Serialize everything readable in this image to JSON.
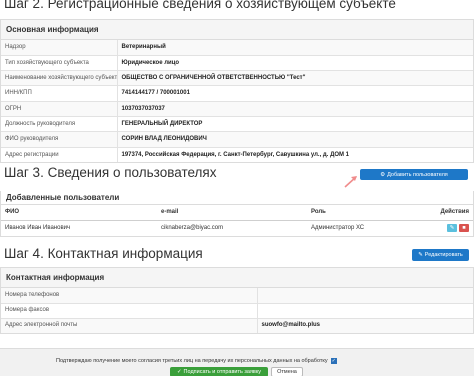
{
  "step2": {
    "title": "Шаг 2. Регистрационные сведения о хозяйствующем субъекте",
    "panel_title": "Основная информация",
    "rows": [
      {
        "label": "Надзор",
        "value": "Ветеринарный"
      },
      {
        "label": "Тип хозяйствующего субъекта",
        "value": "Юридическое лицо"
      },
      {
        "label": "Наименование хозяйствующего субъекта",
        "value": "ОБЩЕСТВО С ОГРАНИЧЕННОЙ ОТВЕТСТВЕННОСТЬЮ \"Тест\""
      },
      {
        "label": "ИНН/КПП",
        "value": "7414144177 / 700001001"
      },
      {
        "label": "ОГРН",
        "value": "1037037037037"
      },
      {
        "label": "Должность руководителя",
        "value": "ГЕНЕРАЛЬНЫЙ ДИРЕКТОР"
      },
      {
        "label": "ФИО руководителя",
        "value": "СОРИН ВЛАД ЛЕОНИДОВИЧ"
      },
      {
        "label": "Адрес регистрации",
        "value": "197374, Российская Федерация, г. Санкт-Петербург, Савушкина ул., д. ДОМ 1"
      }
    ]
  },
  "step3": {
    "title": "Шаг 3. Сведения о пользователях",
    "add_button": "Добавить пользователя",
    "panel_title": "Добавленные пользователи",
    "columns": {
      "fio": "ФИО",
      "email": "e-mail",
      "role": "Роль",
      "actions": "Действия"
    },
    "users": [
      {
        "fio": "Иванов Иван Иванович",
        "email": "ciknaberza@biyac.com",
        "role": "Администратор ХС"
      }
    ]
  },
  "step4": {
    "title": "Шаг 4. Контактная информация",
    "edit_button": "Редактировать",
    "panel_title": "Контактная информация",
    "rows": [
      {
        "label": "Номера телефонов",
        "value": ""
      },
      {
        "label": "Номера факсов",
        "value": ""
      },
      {
        "label": "Адрес электронной почты",
        "value": "suowfo@mailto.plus"
      }
    ]
  },
  "footer": {
    "consent_text": "Подтверждаю получение моего согласия третьих лиц на передачу их персональных данных на обработку",
    "consent_checked": true,
    "submit_button": "Подписать и отправить заявку",
    "cancel_button": "Отмена"
  },
  "icons": {
    "add_user": "gear-icon",
    "edit": "pencil-icon",
    "edit_row": "pencil-icon",
    "delete_row": "trash-icon",
    "submit": "check-icon",
    "annotation": "arrow-icon"
  },
  "colors": {
    "primary": "#1e78c8",
    "success": "#3a9f3a",
    "danger": "#d9534f",
    "info": "#5bc0de",
    "annotation_arrow": "#f08c8c"
  }
}
